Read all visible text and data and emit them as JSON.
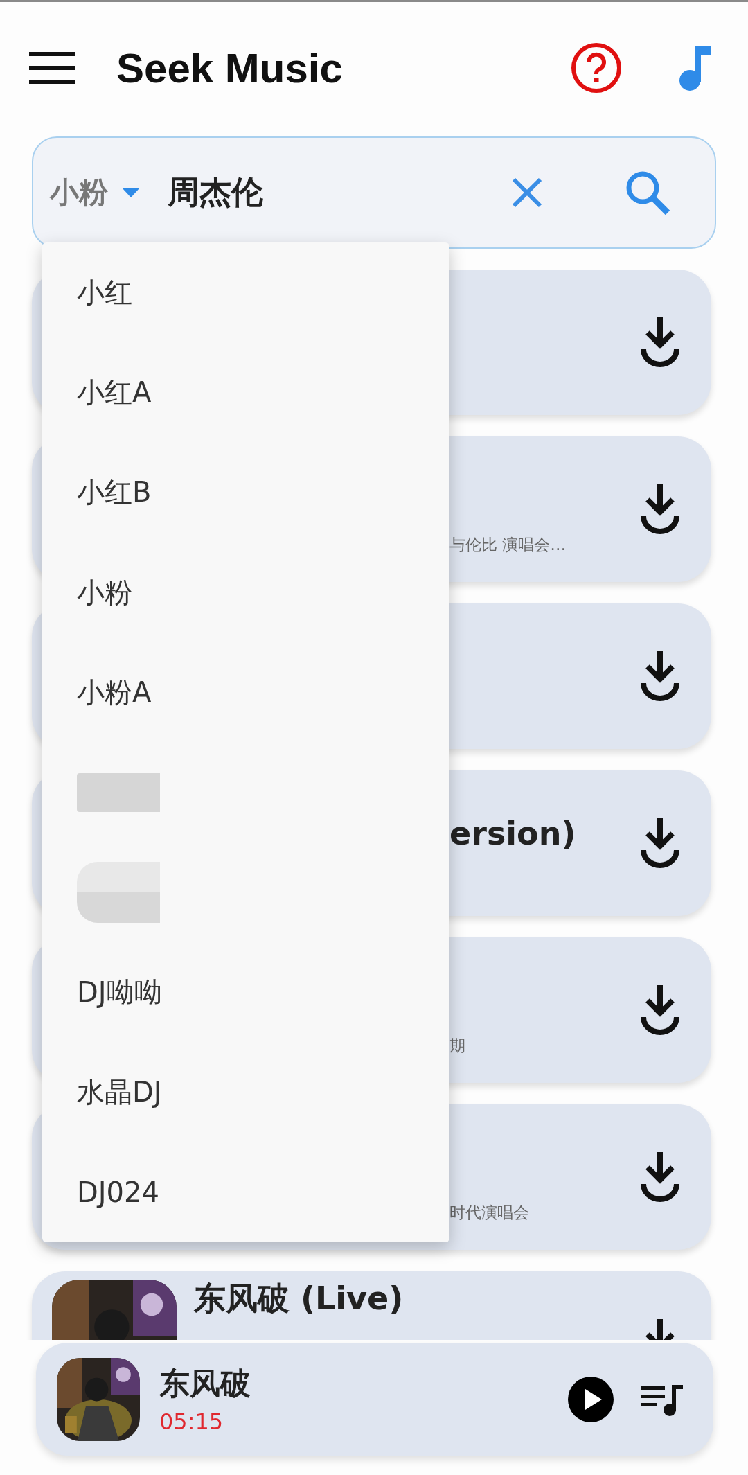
{
  "app_bar": {
    "title": "Seek Music"
  },
  "search": {
    "source": "小粉",
    "value": "周杰伦"
  },
  "source_menu": {
    "items": [
      {
        "kind": "text",
        "label": "小红"
      },
      {
        "kind": "text",
        "label": "小红A"
      },
      {
        "kind": "text",
        "label": "小红B"
      },
      {
        "kind": "text",
        "label": "小粉"
      },
      {
        "kind": "text",
        "label": "小粉A"
      },
      {
        "kind": "redacted"
      },
      {
        "kind": "redacted"
      },
      {
        "kind": "text",
        "label": "DJ呦呦"
      },
      {
        "kind": "text",
        "label": "水晶DJ"
      },
      {
        "kind": "text",
        "label": "DJ024"
      }
    ]
  },
  "results": [
    {
      "kind": "covered"
    },
    {
      "kind": "covered",
      "subtitle": "与伦比 演唱会…"
    },
    {
      "kind": "covered"
    },
    {
      "kind": "covered",
      "title": "ersion)"
    },
    {
      "kind": "covered",
      "subtitle": "期"
    },
    {
      "kind": "covered",
      "subtitle": "时代演唱会"
    },
    {
      "kind": "artwork",
      "title": "东风破 (Live)"
    }
  ],
  "player": {
    "title": "东风破",
    "time": "05:15"
  }
}
